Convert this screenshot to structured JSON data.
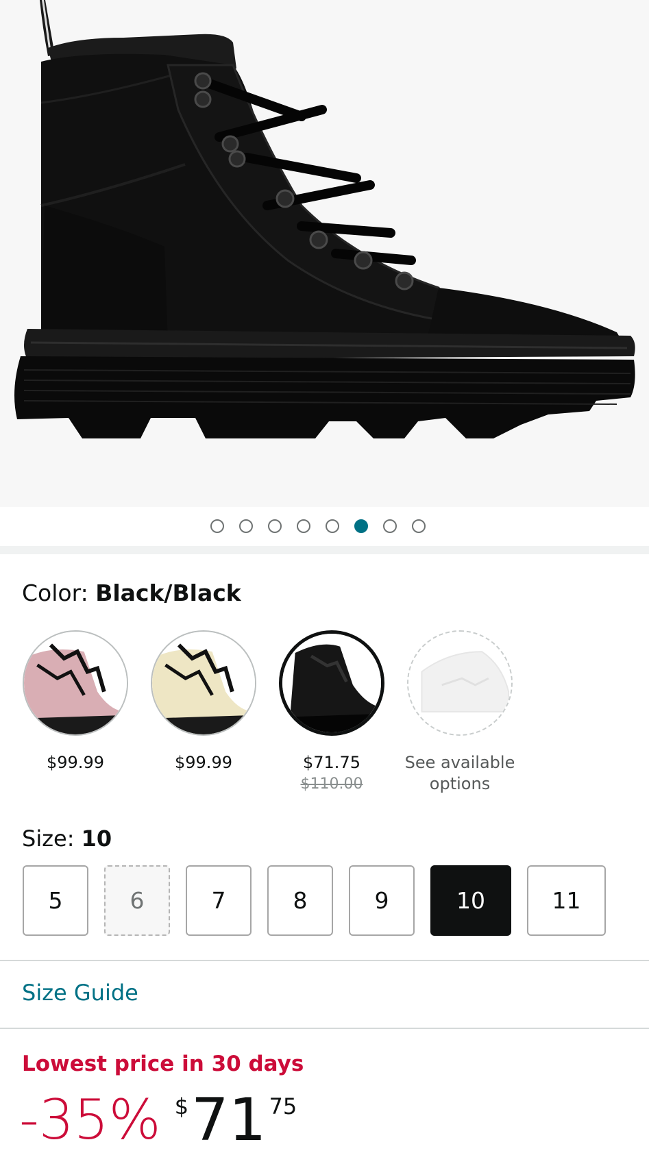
{
  "gallery": {
    "image_name": "black-combat-boot-side-view",
    "dot_count": 8,
    "active_index": 5
  },
  "color": {
    "label": "Color: ",
    "value": "Black/Black",
    "options": [
      {
        "name": "pink-swatch",
        "price": "$99.99",
        "old_price": "",
        "state": "available",
        "color": "#d9aeb4"
      },
      {
        "name": "cream-swatch",
        "price": "$99.99",
        "old_price": "",
        "state": "available",
        "color": "#eee6c4"
      },
      {
        "name": "black-swatch",
        "price": "$71.75",
        "old_price": "$110.00",
        "state": "selected",
        "color": "#161616"
      },
      {
        "name": "white-swatch",
        "price": "",
        "old_price": "",
        "state": "unavailable",
        "options_text_1": "See available",
        "options_text_2": "options",
        "color": "#f4f4f4"
      }
    ]
  },
  "size": {
    "label": "Size: ",
    "value": "10",
    "options": [
      {
        "label": "5",
        "state": "available"
      },
      {
        "label": "6",
        "state": "unavailable"
      },
      {
        "label": "7",
        "state": "available"
      },
      {
        "label": "8",
        "state": "available"
      },
      {
        "label": "9",
        "state": "available"
      },
      {
        "label": "10",
        "state": "selected"
      },
      {
        "label": "11",
        "state": "available"
      }
    ]
  },
  "size_guide": "Size Guide",
  "deal": {
    "badge": "Lowest price in 30 days",
    "discount": "-35%",
    "currency": "$",
    "whole": "71",
    "fraction": "75"
  },
  "colors": {
    "link": "#007185",
    "deal_red": "#cc0c39",
    "active_dot": "#007185"
  }
}
